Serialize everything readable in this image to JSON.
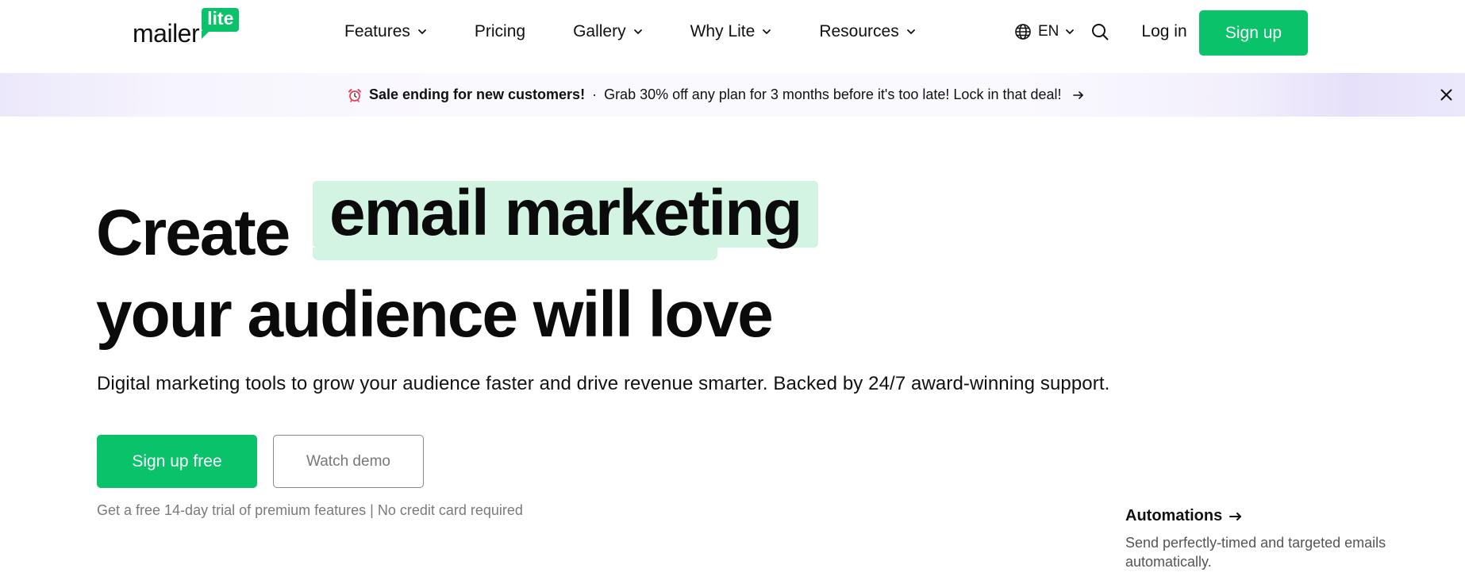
{
  "header": {
    "logo": {
      "word": "mailer",
      "badge": "lite"
    },
    "nav": [
      {
        "label": "Features",
        "dropdown": true
      },
      {
        "label": "Pricing",
        "dropdown": false
      },
      {
        "label": "Gallery",
        "dropdown": true
      },
      {
        "label": "Why Lite",
        "dropdown": true
      },
      {
        "label": "Resources",
        "dropdown": true
      }
    ],
    "language": "EN",
    "login_label": "Log in",
    "signup_label": "Sign up"
  },
  "banner": {
    "strong": "Sale ending for new customers!",
    "separator": "·",
    "message": "Grab 30% off any plan for 3 months before it's too late! Lock in that deal!"
  },
  "hero": {
    "title_prefix": "Create",
    "title_highlight": "email marketing",
    "title_line2": "your audience will love",
    "subtitle": "Digital marketing tools to grow your audience faster and drive revenue smarter. Backed by 24/7 award-winning support.",
    "cta_primary": "Sign up free",
    "cta_secondary": "Watch demo",
    "note": "Get a free 14-day trial of premium features | No credit card required"
  },
  "feature": {
    "title": "Automations",
    "description": "Send perfectly-timed and targeted emails automatically."
  },
  "icons": {
    "dropdown": "chevron-down-icon",
    "language": "globe-icon",
    "search": "search-icon",
    "banner": "alarm-clock-icon",
    "link": "arrow-right-icon",
    "close": "close-icon"
  },
  "colors": {
    "brand_green": "#09c269",
    "highlight": "#d3f4e3",
    "banner_tint": "#ece8fb",
    "text": "#0b0b0b",
    "muted": "#7a7a7a"
  }
}
